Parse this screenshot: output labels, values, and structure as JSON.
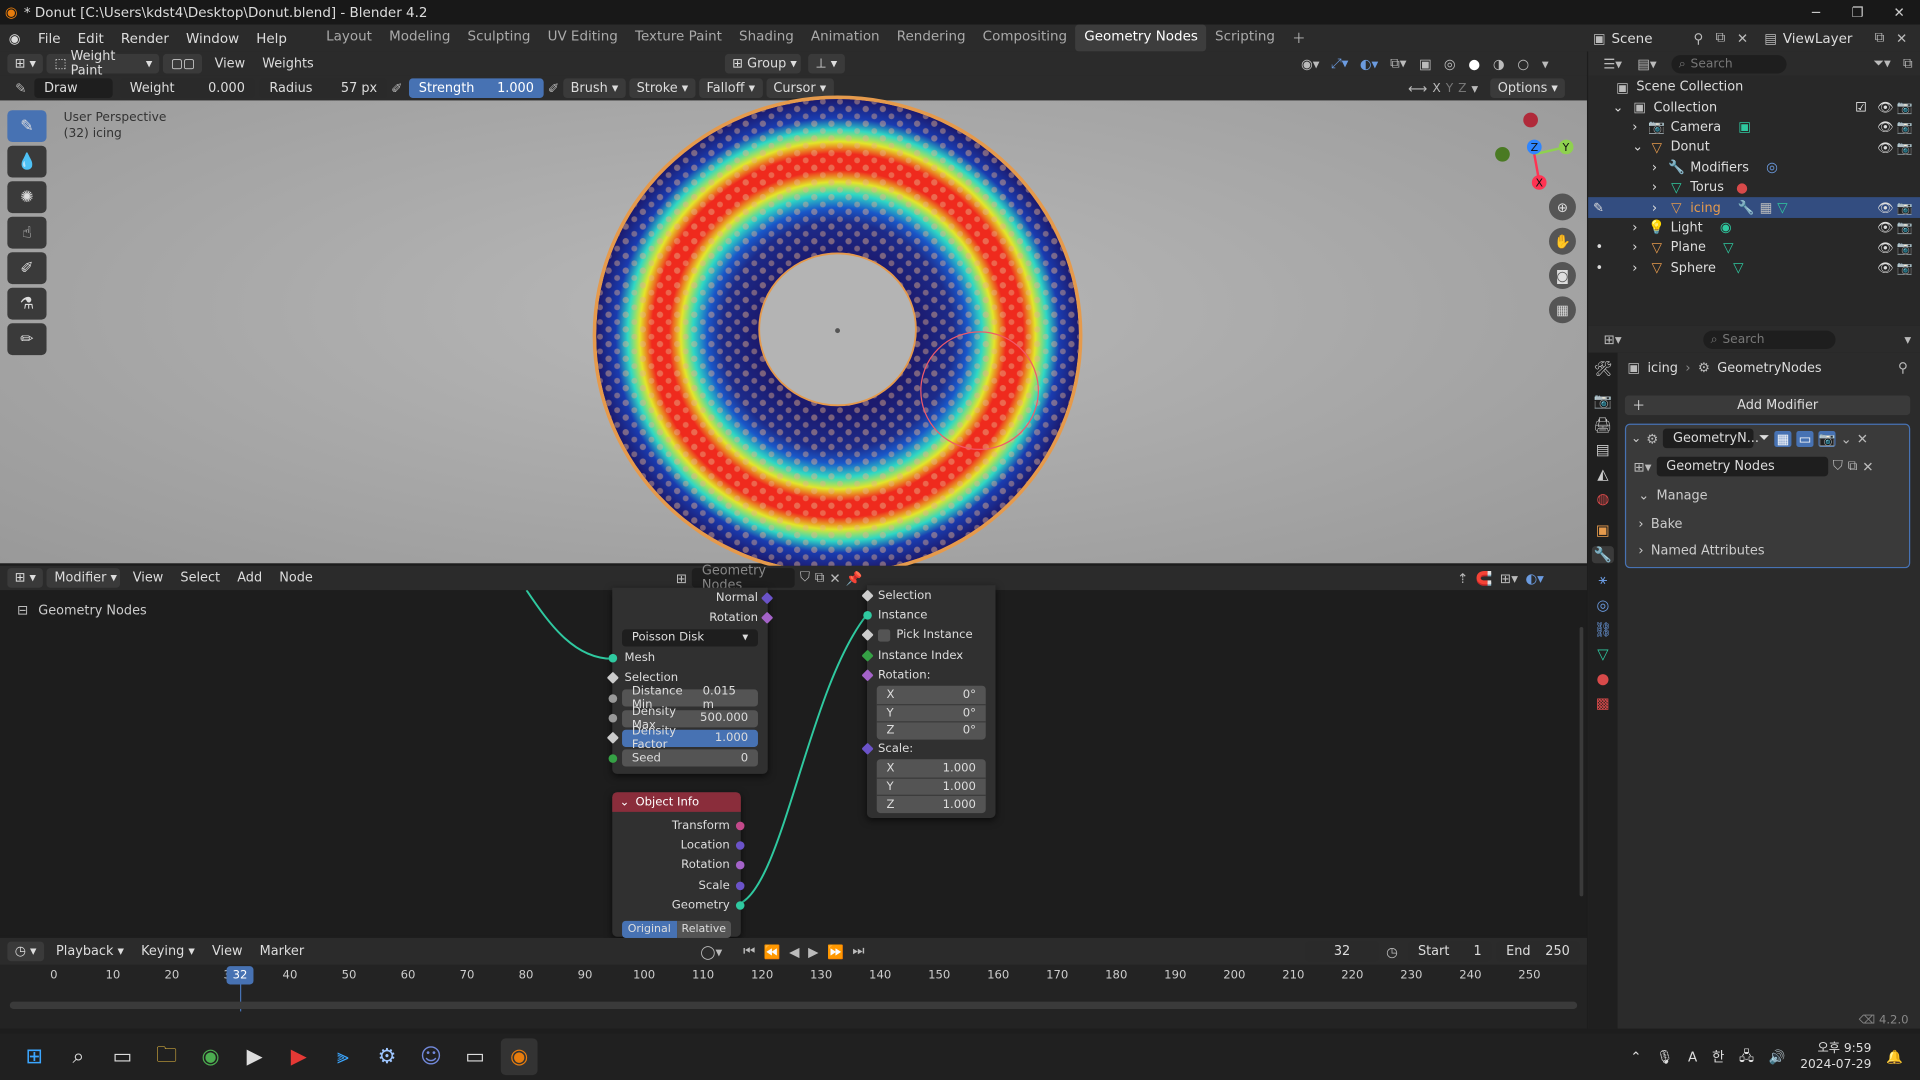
{
  "title_bar": {
    "text": "* Donut [C:\\Users\\kdst4\\Desktop\\Donut.blend] - Blender 4.2"
  },
  "menu": [
    "File",
    "Edit",
    "Render",
    "Window",
    "Help"
  ],
  "workspaces": [
    "Layout",
    "Modeling",
    "Sculpting",
    "UV Editing",
    "Texture Paint",
    "Shading",
    "Animation",
    "Rendering",
    "Compositing",
    "Geometry Nodes",
    "Scripting"
  ],
  "active_workspace": "Geometry Nodes",
  "scene": {
    "label": "Scene",
    "view_layer": "ViewLayer"
  },
  "viewport": {
    "mode": "Weight Paint",
    "menus": [
      "View",
      "Weights"
    ],
    "group": "Group",
    "tool": {
      "name": "Draw",
      "weight_label": "Weight",
      "weight_value": "0.000",
      "radius_label": "Radius",
      "radius_value": "57 px",
      "strength_label": "Strength",
      "strength_value": "1.000"
    },
    "dropdowns": [
      "Brush",
      "Stroke",
      "Falloff",
      "Cursor"
    ],
    "options": "Options",
    "overlay_text": [
      "User Perspective",
      "(32) icing"
    ],
    "axes": {
      "x": "X",
      "y": "Y",
      "z": "Z"
    }
  },
  "node_editor": {
    "type": "Modifier",
    "menus": [
      "View",
      "Select",
      "Add",
      "Node"
    ],
    "tree_name": "Geometry Nodes",
    "breadcrumb": "Geometry Nodes",
    "distribute": {
      "outputs": [
        "Normal",
        "Rotation"
      ],
      "mode": "Poisson Disk",
      "inputs": [
        "Mesh",
        "Selection"
      ],
      "distance_min": {
        "label": "Distance Min",
        "value": "0.015 m"
      },
      "density_max": {
        "label": "Density Max",
        "value": "500.000"
      },
      "density_factor": {
        "label": "Density Factor",
        "value": "1.000"
      },
      "seed": {
        "label": "Seed",
        "value": "0"
      }
    },
    "instance": {
      "rows": [
        "Selection",
        "Instance",
        "Pick Instance",
        "Instance Index",
        "Rotation:"
      ],
      "rotation": [
        {
          "axis": "X",
          "value": "0°"
        },
        {
          "axis": "Y",
          "value": "0°"
        },
        {
          "axis": "Z",
          "value": "0°"
        }
      ],
      "scale_label": "Scale:",
      "scale": [
        {
          "axis": "X",
          "value": "1.000"
        },
        {
          "axis": "Y",
          "value": "1.000"
        },
        {
          "axis": "Z",
          "value": "1.000"
        }
      ]
    },
    "object_info": {
      "title": "Object Info",
      "outputs": [
        "Transform",
        "Location",
        "Rotation",
        "Scale",
        "Geometry"
      ],
      "toggle": [
        "Original",
        "Relative"
      ]
    }
  },
  "timeline": {
    "menus": [
      "Playback",
      "Keying",
      "View",
      "Marker"
    ],
    "current_frame": "32",
    "start_label": "Start",
    "start": "1",
    "end_label": "End",
    "end": "250",
    "ticks": [
      "0",
      "10",
      "20",
      "30",
      "40",
      "50",
      "60",
      "70",
      "80",
      "90",
      "100",
      "110",
      "120",
      "130",
      "140",
      "150",
      "160",
      "170",
      "180",
      "190",
      "200",
      "210",
      "220",
      "230",
      "240",
      "250"
    ],
    "marker_frame": "32"
  },
  "outliner": {
    "search_placeholder": "Search",
    "root": "Scene Collection",
    "collection": "Collection",
    "items": [
      {
        "name": "Camera",
        "level": 1
      },
      {
        "name": "Donut",
        "level": 1
      },
      {
        "name": "Modifiers",
        "level": 2
      },
      {
        "name": "Torus",
        "level": 2
      },
      {
        "name": "icing",
        "level": 2,
        "selected": true
      },
      {
        "name": "Light",
        "level": 1
      },
      {
        "name": "Plane",
        "level": 1
      },
      {
        "name": "Sphere",
        "level": 1
      }
    ]
  },
  "properties": {
    "search_placeholder": "Search",
    "breadcrumb_object": "icing",
    "breadcrumb_modifier": "GeometryNodes",
    "add_modifier": "Add Modifier",
    "modifier_name": "GeometryN...",
    "node_group": "Geometry Nodes",
    "panels": [
      "Manage",
      "Bake",
      "Named Attributes"
    ]
  },
  "version": "4.2.0",
  "taskbar": {
    "time": "오후 9:59",
    "date": "2024-07-29",
    "ime": "A",
    "ime2": "한"
  },
  "colors": {
    "accent": "#4772b3",
    "selection": "#334d80",
    "object_info_header": "#8a2d3b"
  }
}
